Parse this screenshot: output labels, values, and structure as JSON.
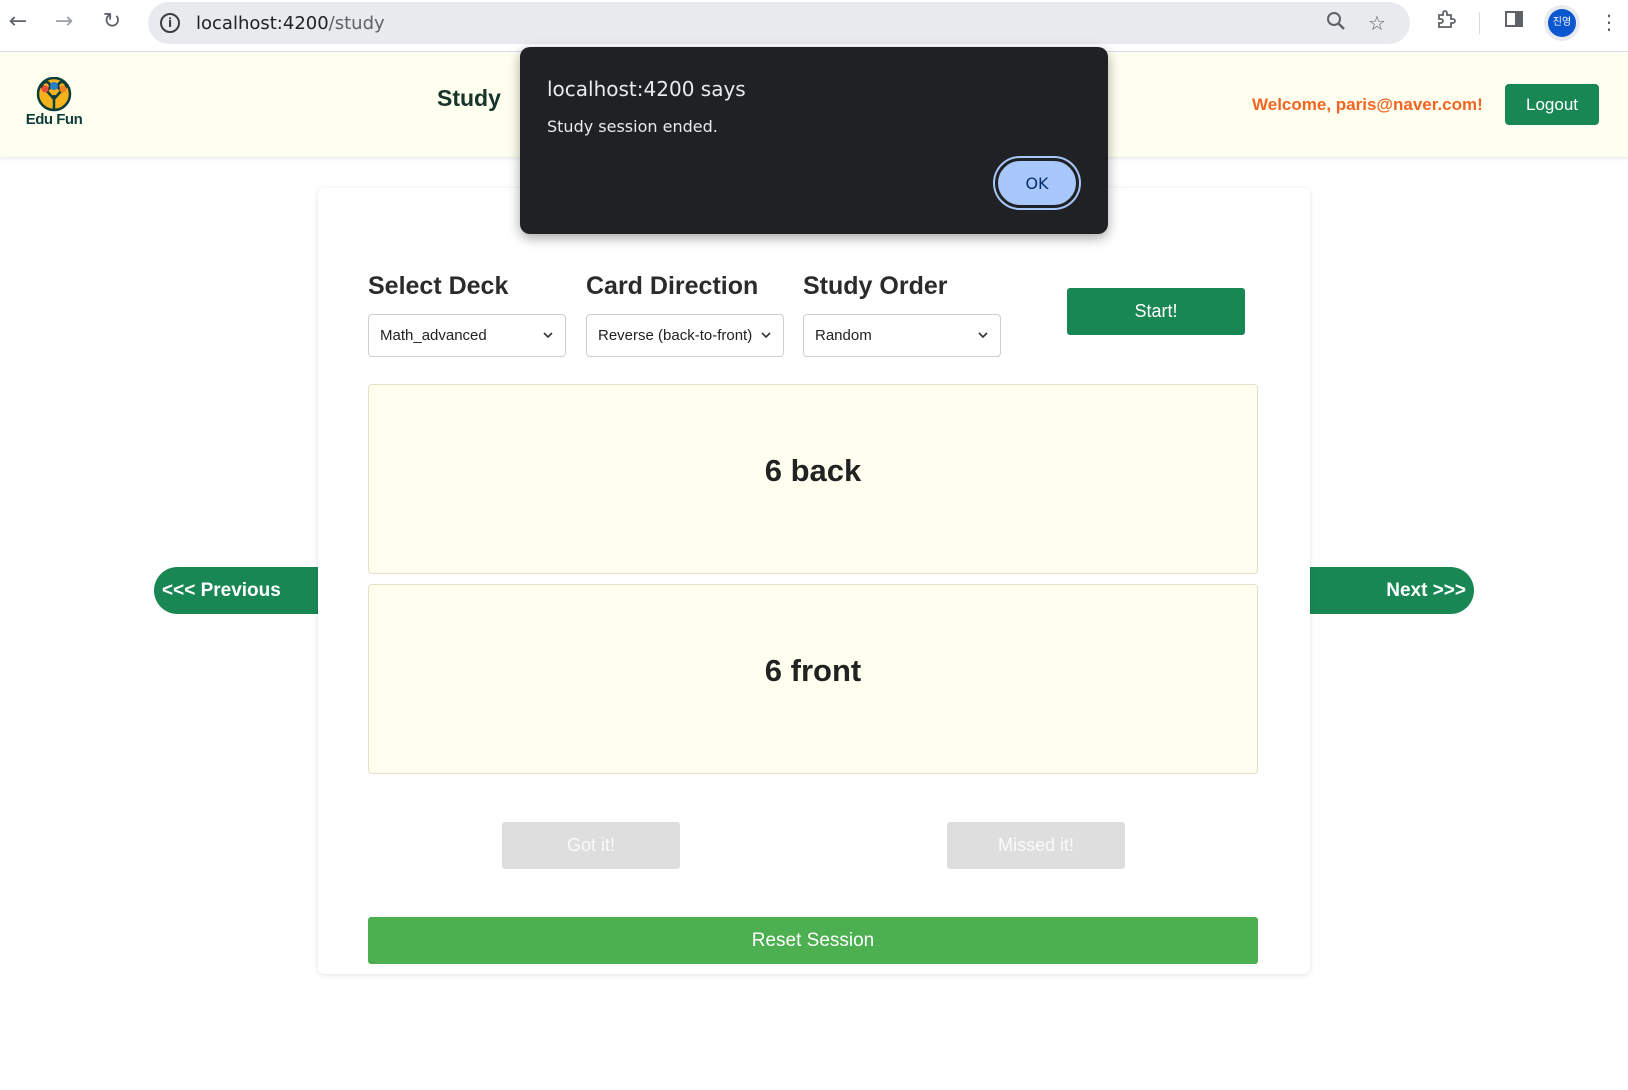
{
  "browser": {
    "url_host": "localhost:4200",
    "url_path": "/study",
    "profile_initials": "진영",
    "icons": [
      "back-arrow-icon",
      "forward-arrow-icon",
      "reload-icon",
      "info-icon",
      "zoom-icon",
      "star-icon",
      "extensions-icon",
      "side-panel-icon",
      "kebab-menu-icon"
    ]
  },
  "header": {
    "logo_text": "Edu Fun",
    "nav_study": "Study",
    "welcome": "Welcome,  paris@naver.com!",
    "logout_label": "Logout",
    "colors": {
      "background": "#fffff0",
      "accent": "#198754",
      "welcome": "#f26522"
    }
  },
  "study": {
    "deck_label": "Select Deck",
    "deck_value": "Math_advanced",
    "direction_label": "Card Direction",
    "direction_value": "Reverse (back-to-front)",
    "order_label": "Study Order",
    "order_value": "Random",
    "start_label": "Start!",
    "card_top": "6 back",
    "card_bottom": "6 front",
    "got_it_label": "Got it!",
    "missed_it_label": "Missed it!",
    "reset_label": "Reset Session",
    "prev_label": "<<< Previous",
    "next_label": "Next >>>"
  },
  "dialog": {
    "title": "localhost:4200 says",
    "message": "Study session ended.",
    "ok_label": "OK"
  }
}
